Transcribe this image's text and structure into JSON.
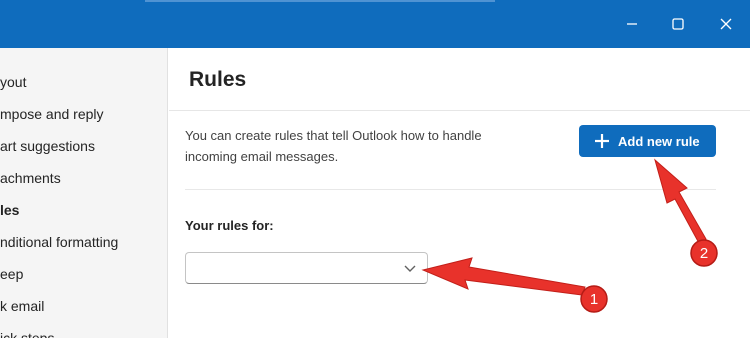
{
  "window": {
    "minimize_icon": "minimize-icon",
    "maximize_icon": "maximize-icon",
    "close_icon": "close-icon"
  },
  "sidebar": {
    "items": [
      {
        "label": "yout"
      },
      {
        "label": "mpose and reply"
      },
      {
        "label": "art suggestions"
      },
      {
        "label": "achments"
      },
      {
        "label": "les",
        "active": true
      },
      {
        "label": "nditional formatting"
      },
      {
        "label": "eep"
      },
      {
        "label": "k email"
      },
      {
        "label": "ick steps"
      }
    ]
  },
  "main": {
    "title": "Rules",
    "description": "You can create rules that tell Outlook how to handle incoming email messages.",
    "add_rule_button": {
      "label": "Add new rule",
      "icon": "plus-icon"
    },
    "rules_for_label": "Your rules for:",
    "rules_for_dropdown": {
      "value": "",
      "icon": "chevron-down-icon"
    }
  },
  "annotations": {
    "badge_1": "1",
    "badge_2": "2",
    "color": "#e8322b"
  },
  "colors": {
    "accent": "#0f6cbd",
    "sidebar_bg": "#f5f5f5"
  }
}
